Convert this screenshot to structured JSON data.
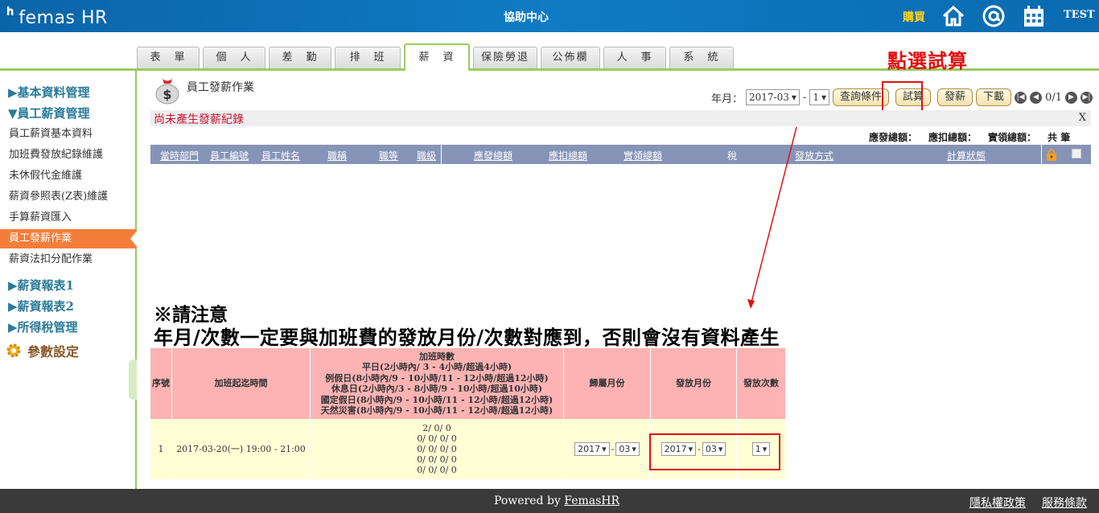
{
  "header": {
    "logo_mark": "ᑋ",
    "logo_text": "femas HR",
    "help_center": "協助中心",
    "buy": "購買",
    "user": "TEST",
    "icons": [
      "home-icon",
      "at-icon",
      "calendar-icon"
    ]
  },
  "tabs": [
    {
      "label": "表　單"
    },
    {
      "label": "個　人"
    },
    {
      "label": "差　勤"
    },
    {
      "label": "排　班"
    },
    {
      "label": "薪　資",
      "active": true
    },
    {
      "label": "保險勞退"
    },
    {
      "label": "公佈欄"
    },
    {
      "label": "人　事"
    },
    {
      "label": "系　統"
    }
  ],
  "annotation_top": "點選試算",
  "sidebar": {
    "sections": [
      "▶基本資料管理",
      "▼員工薪資管理",
      "▶薪資報表1",
      "▶薪資報表2",
      "▶所得稅管理"
    ],
    "items": [
      "員工薪資基本資料",
      "加班費發放紀錄維護",
      "未休假代金維護",
      "薪資參照表(Z表)維護",
      "手算薪資匯入",
      "員工發薪作業",
      "薪資法扣分配作業"
    ],
    "param": "參數設定"
  },
  "main": {
    "title": "員工發薪作業",
    "ym_label": "年月：",
    "ym_value": "2017-03",
    "times_value": "1",
    "btn_query": "查詢條件",
    "btn_trial": "試算",
    "btn_pay": "發薪",
    "btn_download": "下載",
    "page_info": "0/1",
    "message": "尚未產生發薪紀錄",
    "close": "X",
    "totals": [
      "應發總額：",
      "應扣總額：",
      "實領總額：",
      "共 筆"
    ],
    "columns": [
      "當時部門",
      "員工編號",
      "員工姓名",
      "職稱",
      "職等",
      "職級",
      "應發總額",
      "應扣總額",
      "實領總額",
      "稅",
      "發放方式",
      "計算狀態"
    ]
  },
  "warning": {
    "line1": "※請注意",
    "line2": "年月/次數一定要與加班費的發放月份/次數對應到，否則會沒有資料產生"
  },
  "ot_table": {
    "headers": {
      "seq": "序號",
      "period": "加班起迄時間",
      "hours_title": "加班時數",
      "hours_lines": [
        "平日(2小時內/ 3 - 4小時/超過4小時)",
        "例假日(8小時內/9 - 10小時/11 - 12小時/超過12小時)",
        "休息日(2小時內/3 - 8小時/9 - 10小時/超過10小時)",
        "國定假日(8小時內/9 - 10小時/11 - 12小時/超過12小時)",
        "天然災害(8小時內/9 - 10小時/11 - 12小時/超過12小時)"
      ],
      "belong": "歸屬月份",
      "pay_month": "發放月份",
      "pay_times": "發放次數"
    },
    "row": {
      "seq": "1",
      "period": "2017-03-20(一) 19:00 - 21:00",
      "hours": [
        "2/ 0/ 0",
        "0/ 0/ 0/ 0",
        "0/ 0/ 0/ 0",
        "0/ 0/ 0/ 0",
        "0/ 0/ 0/ 0"
      ],
      "belong_year": "2017",
      "belong_month": "03",
      "pay_year": "2017",
      "pay_month": "03",
      "pay_times": "1"
    }
  },
  "footer": {
    "powered": "Powered by",
    "brand": "FemasHR",
    "privacy": "隱私權政策",
    "terms": "服務條款"
  }
}
